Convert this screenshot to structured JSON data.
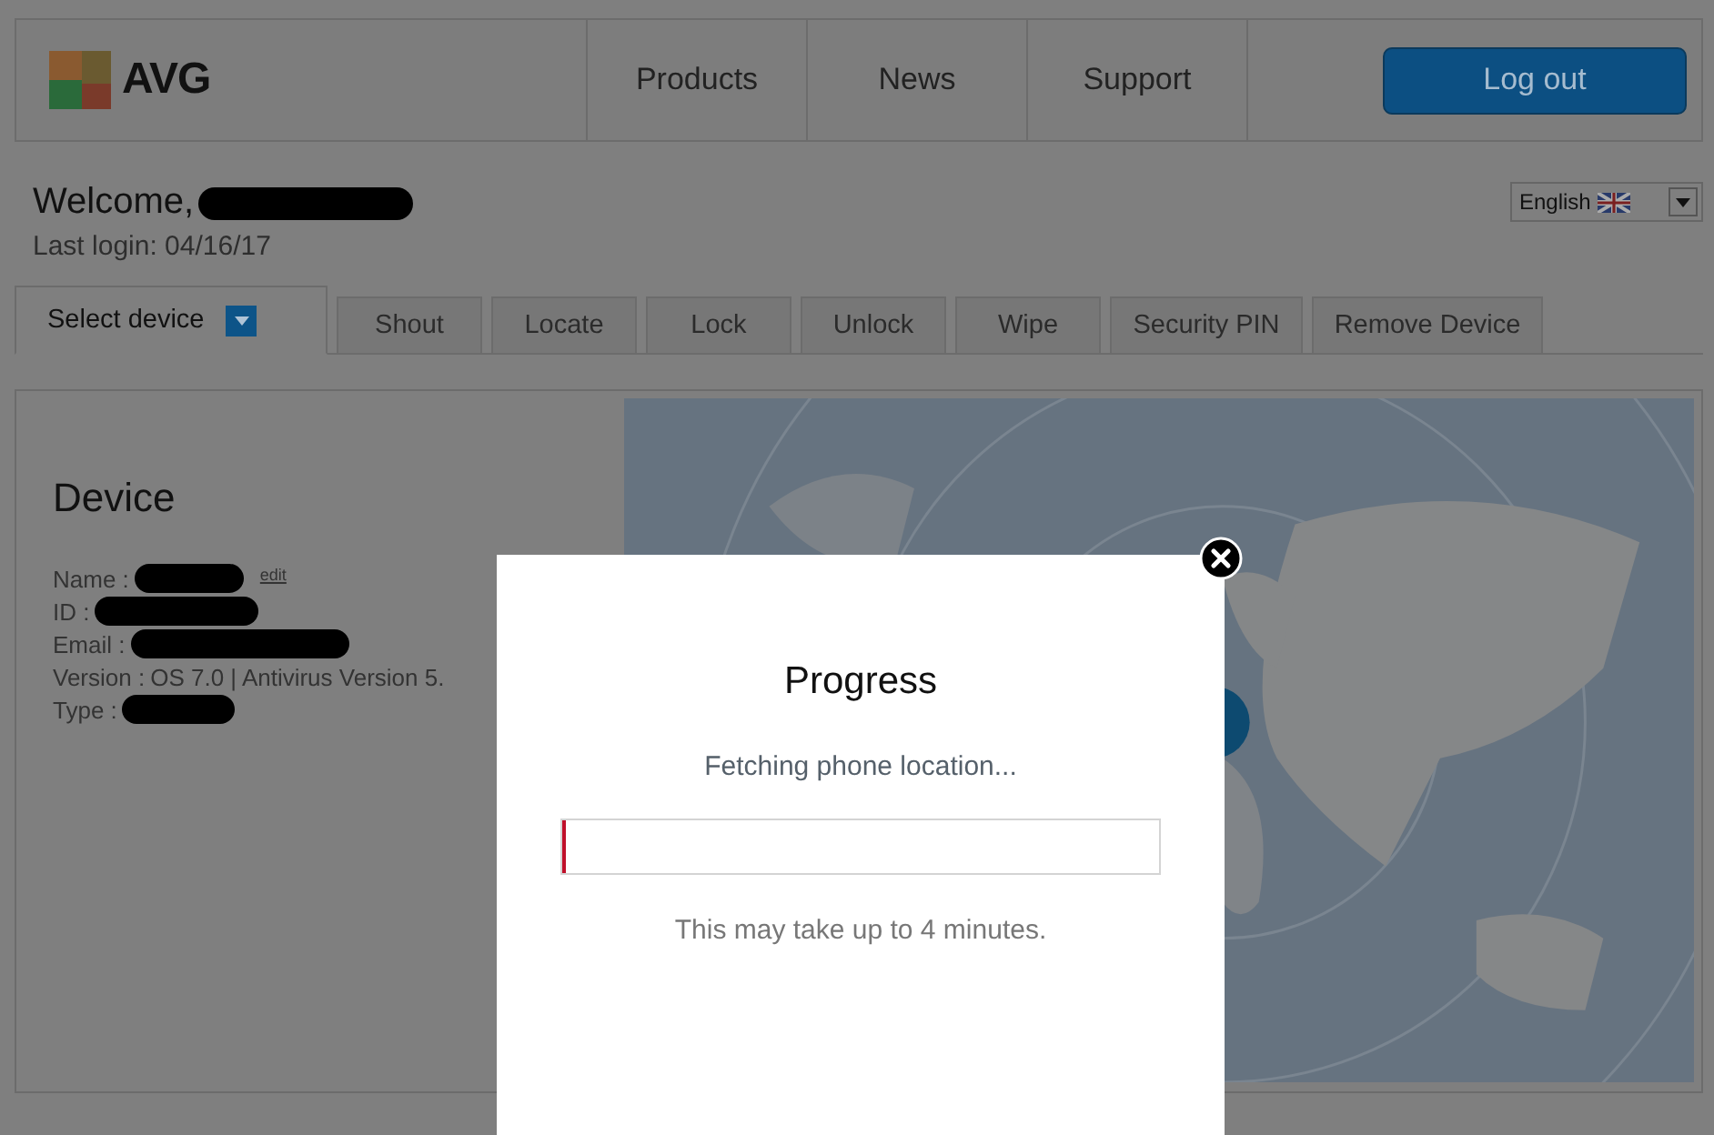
{
  "header": {
    "logo": "AVG",
    "nav": [
      "Products",
      "News",
      "Support"
    ],
    "logout": "Log out"
  },
  "welcome": {
    "greeting": "Welcome,",
    "last_login": "Last login: 04/16/17"
  },
  "language": {
    "value": "English"
  },
  "tabs": [
    {
      "label": "Select device",
      "kind": "dropdown",
      "selected": true
    },
    {
      "label": "Shout",
      "kind": "action",
      "selected": false
    },
    {
      "label": "Locate",
      "kind": "action",
      "selected": false
    },
    {
      "label": "Lock",
      "kind": "action",
      "selected": false
    },
    {
      "label": "Unlock",
      "kind": "action",
      "selected": false
    },
    {
      "label": "Wipe",
      "kind": "action",
      "selected": false
    },
    {
      "label": "Security PIN",
      "kind": "action",
      "selected": false
    },
    {
      "label": "Remove Device",
      "kind": "action",
      "selected": false
    }
  ],
  "device": {
    "title": "Device",
    "fields": [
      {
        "label": "Name :",
        "kind": "redacted",
        "edit": "edit"
      },
      {
        "label": "ID :",
        "kind": "redacted"
      },
      {
        "label": "Email :",
        "kind": "redacted"
      },
      {
        "label": "Version :",
        "kind": "text",
        "value": "OS 7.0 | Antivirus Version 5."
      },
      {
        "label": "Type :",
        "kind": "redacted"
      }
    ]
  },
  "dialog": {
    "title": "Progress",
    "message": "Fetching phone location...",
    "level": 0.005,
    "note": "This may take up to 4 minutes."
  }
}
